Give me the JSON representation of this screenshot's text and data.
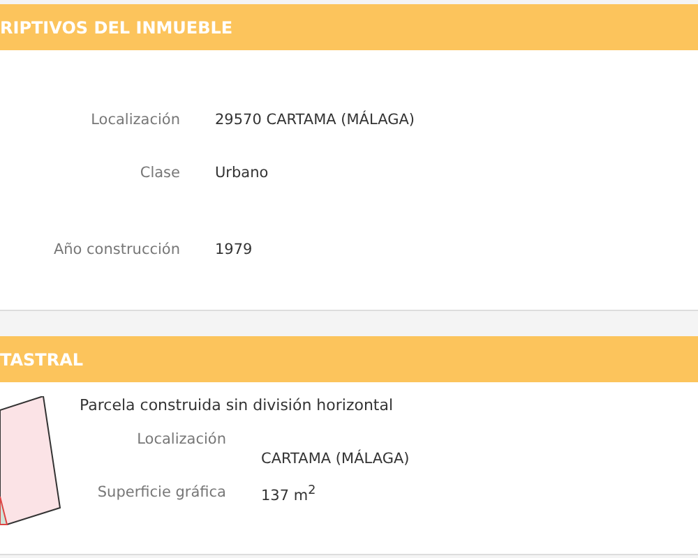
{
  "sections": [
    {
      "title": "RIPTIVOS DEL INMUEBLE",
      "kind": "fields",
      "rows": [
        {
          "label": "Localización",
          "value": "29570 CARTAMA (MÁLAGA)"
        },
        {
          "label": "Clase",
          "value": "Urbano"
        },
        {
          "label": "Año construcción",
          "value": "1979"
        }
      ]
    },
    {
      "title": "TASTRAL",
      "kind": "parcel",
      "description": "Parcela construida sin división horizontal",
      "rows": [
        {
          "label": "Localización",
          "value": "CARTAMA (MÁLAGA)"
        },
        {
          "label": "Superficie gráfica",
          "value": "137 m$^{2}$"
        }
      ]
    }
  ]
}
